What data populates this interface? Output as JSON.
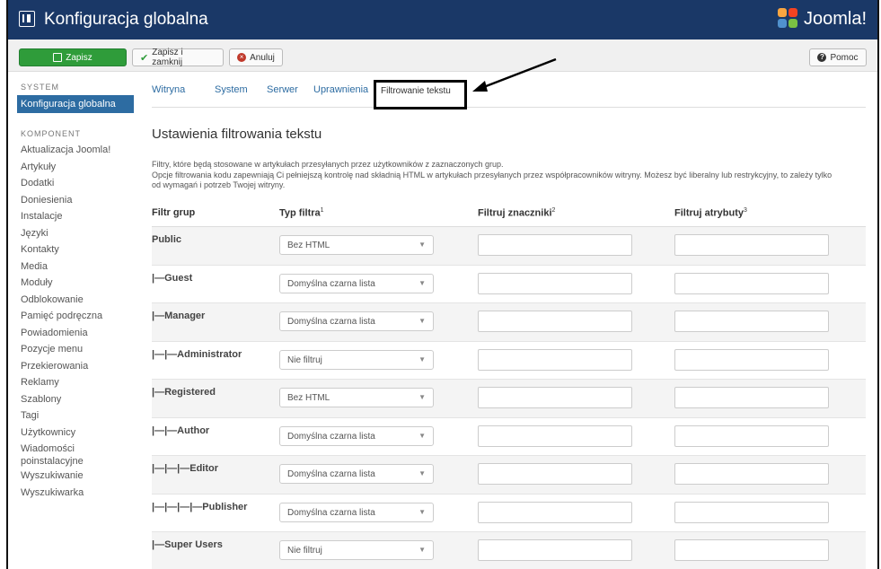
{
  "app": {
    "title": "Konfiguracja globalna",
    "logo_text": "Joomla!"
  },
  "toolbar": {
    "save": "Zapisz",
    "save_close": "Zapisz i zamknij",
    "cancel": "Anuluj",
    "help": "Pomoc"
  },
  "sidebar": {
    "system_header": "SYSTEM",
    "active_item": "Konfiguracja globalna",
    "component_header": "KOMPONENT",
    "items": [
      "Aktualizacja Joomla!",
      "Artykuły",
      "Dodatki",
      "Doniesienia",
      "Instalacje",
      "Języki",
      "Kontakty",
      "Media",
      "Moduły",
      "Odblokowanie",
      "Pamięć podręczna",
      "Powiadomienia",
      "Pozycje menu",
      "Przekierowania",
      "Reklamy",
      "Szablony",
      "Tagi",
      "Użytkownicy",
      "Wiadomości poinstalacyjne",
      "Wyszukiwanie",
      "Wyszukiwarka"
    ]
  },
  "tabs": [
    "Witryna",
    "System",
    "Serwer",
    "Uprawnienia",
    "Filtrowanie tekstu"
  ],
  "main": {
    "heading": "Ustawienia filtrowania tekstu",
    "desc_1": "Filtry, które będą stosowane w artykułach przesyłanych przez użytkowników z zaznaczonych grup.",
    "desc_2": "Opcje filtrowania kodu zapewniają Ci pełniejszą kontrolę nad składnią HTML w artykułach przesyłanych przez współpracowników witryny. Możesz być liberalny lub restrykcyjny, to zależy tylko od wymagań i potrzeb Twojej witryny."
  },
  "table": {
    "col_group": "Filtr grup",
    "col_type": "Typ filtra",
    "col_tags": "Filtruj znaczniki",
    "col_attrs": "Filtruj atrybuty",
    "sup1": "1",
    "sup2": "2",
    "sup3": "3",
    "rows": [
      {
        "group": "Public",
        "filter": "Bez HTML"
      },
      {
        "group": "|—Guest",
        "filter": "Domyślna czarna lista"
      },
      {
        "group": "|—Manager",
        "filter": "Domyślna czarna lista"
      },
      {
        "group": "|—|—Administrator",
        "filter": "Nie filtruj"
      },
      {
        "group": "|—Registered",
        "filter": "Bez HTML"
      },
      {
        "group": "|—|—Author",
        "filter": "Domyślna czarna lista"
      },
      {
        "group": "|—|—|—Editor",
        "filter": "Domyślna czarna lista"
      },
      {
        "group": "|—|—|—|—Publisher",
        "filter": "Domyślna czarna lista"
      },
      {
        "group": "|—Super Users",
        "filter": "Nie filtruj"
      }
    ]
  },
  "colors": {
    "topbar": "#1a3867",
    "save_button": "#2f9c3a",
    "active_sidebar": "#2d6ca2",
    "link": "#2d6ca2"
  }
}
